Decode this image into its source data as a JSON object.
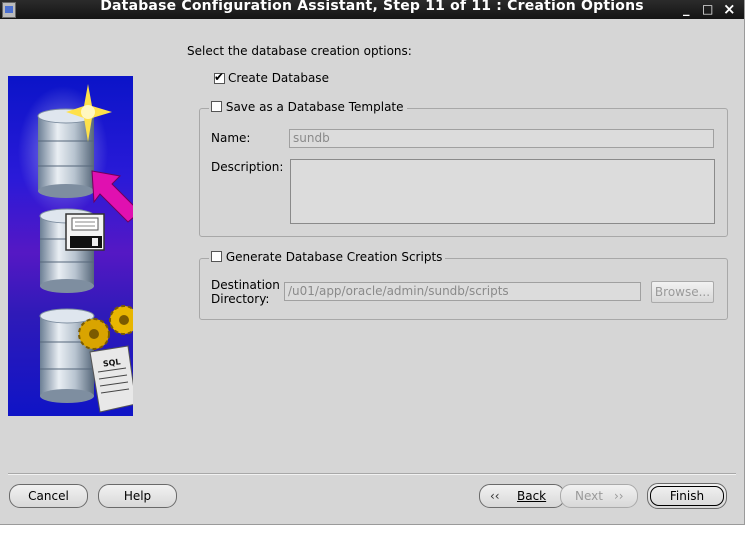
{
  "window": {
    "title": "Database Configuration Assistant, Step 11 of 11 : Creation Options"
  },
  "titlebar_buttons": {
    "minimize": "_",
    "maximize": "□",
    "close": "×"
  },
  "instructions": "Select the database creation options:",
  "options": {
    "create_database": {
      "label": "Create Database",
      "checked": true
    },
    "save_template": {
      "label": "Save as a Database Template",
      "checked": false,
      "name_label": "Name:",
      "name_value": "sundb",
      "description_label": "Description:",
      "description_value": ""
    },
    "generate_scripts": {
      "label": "Generate Database Creation Scripts",
      "checked": false,
      "destination_label_1": "Destination",
      "destination_label_2": "Directory:",
      "destination_value": "/u01/app/oracle/admin/sundb/scripts",
      "browse_label": "Browse..."
    }
  },
  "illustration": {
    "sql_label": "SQL"
  },
  "buttons": {
    "cancel": "Cancel",
    "help": "Help",
    "back": "Back",
    "next": "Next",
    "finish": "Finish"
  },
  "colors": {
    "titlebar": "#1a1a1a",
    "window_bg": "#d6d6d6",
    "panel_blue": "#0b14c8",
    "accent_magenta": "#e010b0"
  }
}
